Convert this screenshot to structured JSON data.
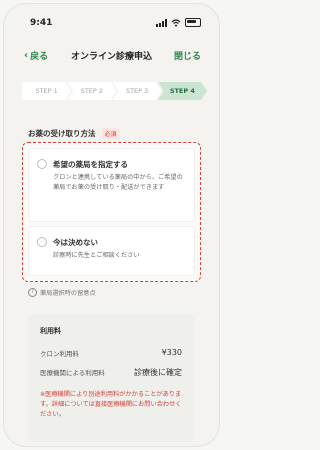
{
  "status": {
    "time": "9:41"
  },
  "nav": {
    "back_label": "戻る",
    "title": "オンライン診療申込",
    "close_label": "閉じる"
  },
  "steps": [
    {
      "label": "STEP 1",
      "active": false
    },
    {
      "label": "STEP 2",
      "active": false
    },
    {
      "label": "STEP 3",
      "active": false
    },
    {
      "label": "STEP 4",
      "active": true
    }
  ],
  "section": {
    "title": "お薬の受け取り方法",
    "required_badge": "必須"
  },
  "options": [
    {
      "title": "希望の薬局を指定する",
      "description": "クロンと連携している薬局の中から、ご希望の薬局でお薬の受け取り・配送ができます"
    },
    {
      "title": "今は決めない",
      "description": "診察時に先生とご相談ください"
    }
  ],
  "notice": {
    "text": "薬局選択時の留意点"
  },
  "fees": {
    "heading": "利用料",
    "rows": [
      {
        "label": "クロン利用料",
        "value": "¥330"
      },
      {
        "label": "医療機関による利用料",
        "value": "診療後に確定"
      }
    ],
    "note": "※医療機関により別途利用料がかかることがあります。詳細については直接医療機関にお問い合わせください。"
  },
  "colors": {
    "accent": "#2f8a52",
    "alert": "#d3433a",
    "step_active_bg": "#cbe5d2"
  }
}
